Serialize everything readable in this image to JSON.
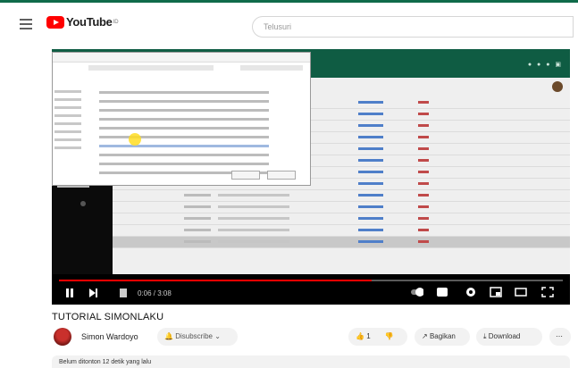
{
  "header": {
    "logo_text": "YouTube",
    "logo_region": "ID",
    "search_placeholder": "Telusuri"
  },
  "player": {
    "time": "0:06 / 3:08",
    "progress": 0.62
  },
  "video": {
    "title": "TUTORIAL SIMONLAKU",
    "channel": "Simon Wardoyo",
    "subscribe_label": "Disubscribe",
    "like_count": "1",
    "share_label": "Bagikan",
    "download_label": "Download",
    "description": "Belum ditonton  12 detik yang lalu"
  },
  "colors": {
    "brand_red": "#ff0000",
    "app_green": "#0f5c43"
  }
}
